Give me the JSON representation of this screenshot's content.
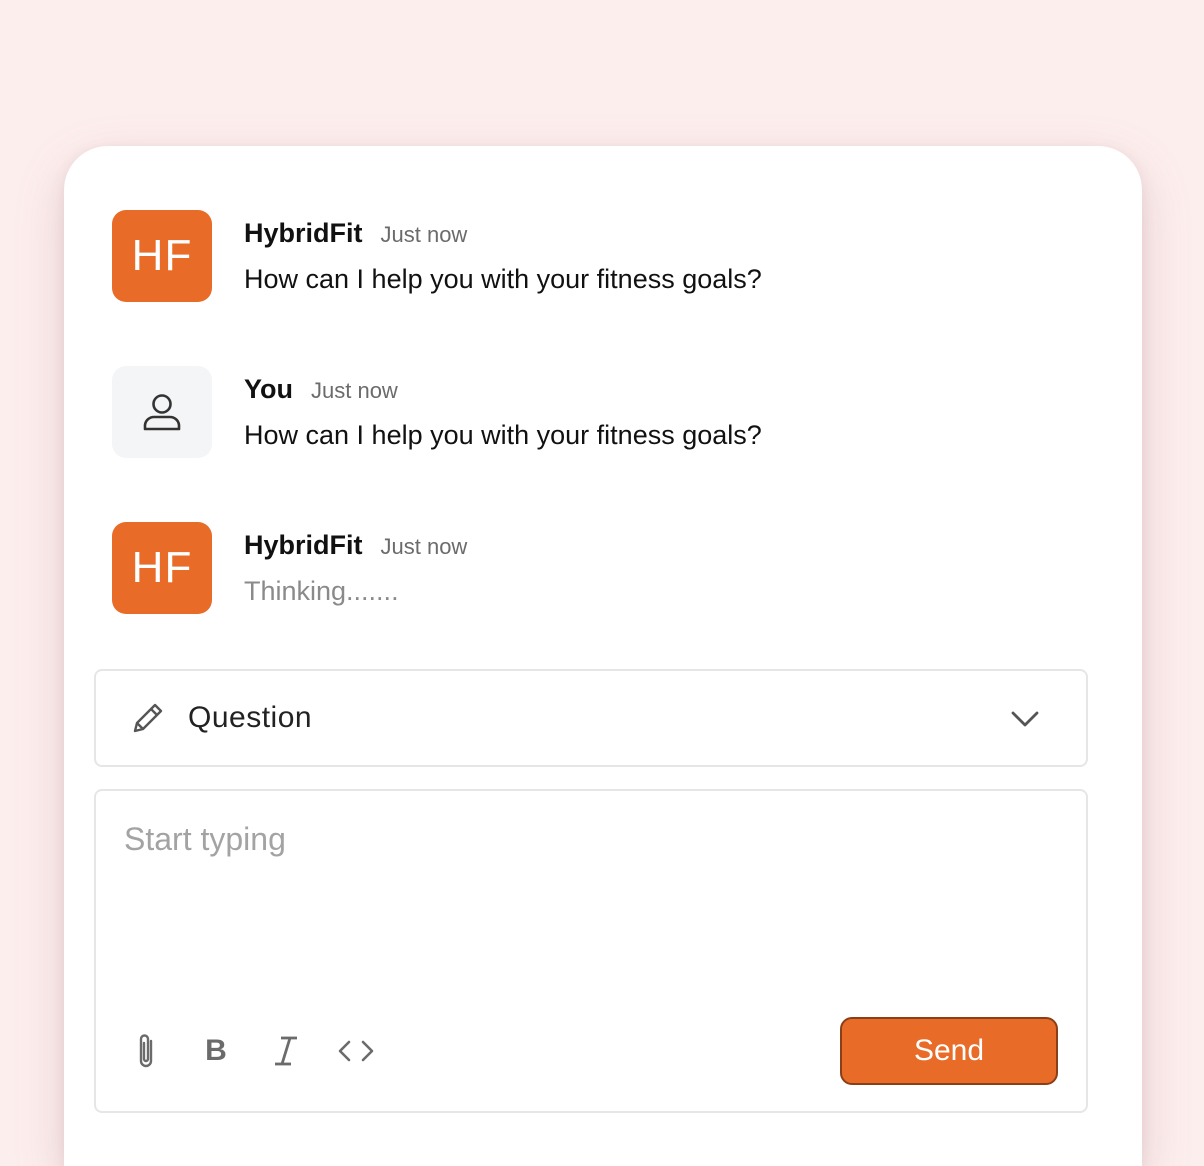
{
  "colors": {
    "background": "#fdeeee",
    "brand": "#e96b28",
    "panel": "#ffffff"
  },
  "messages": [
    {
      "avatar_text": "HF",
      "sender": "HybridFit",
      "time": "Just now",
      "text": "How can I help you with your fitness goals?"
    },
    {
      "avatar_icon": "user-icon",
      "sender": "You",
      "time": "Just now",
      "text": "How can I help you with your fitness goals?"
    },
    {
      "avatar_text": "HF",
      "sender": "HybridFit",
      "time": "Just now",
      "text": "Thinking......."
    }
  ],
  "mode_select": {
    "icon": "pencil-icon",
    "selected": "Question",
    "chevron_icon": "chevron-down-icon"
  },
  "composer": {
    "placeholder": "Start typing",
    "value": "",
    "tools": [
      {
        "icon": "paperclip-icon"
      },
      {
        "icon": "bold-icon",
        "label": "B"
      },
      {
        "icon": "italic-icon",
        "label": "I"
      },
      {
        "icon": "code-icon"
      }
    ],
    "send_label": "Send"
  }
}
